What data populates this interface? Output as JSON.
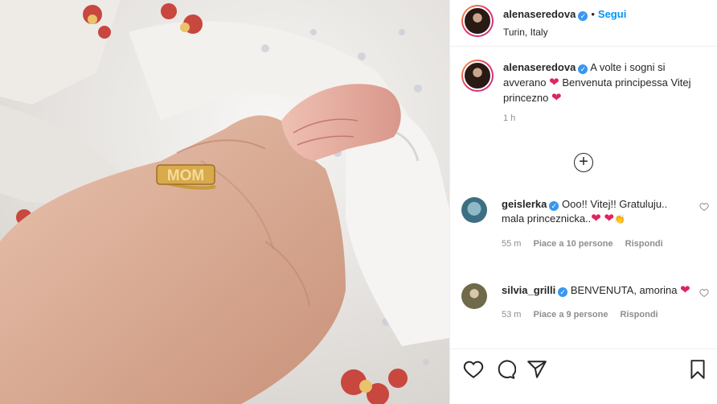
{
  "post": {
    "username": "alenaseredova",
    "follow_label": "Segui",
    "separator": "•",
    "location": "Turin, Italy"
  },
  "photo": {
    "ring_text": "MOM"
  },
  "caption": {
    "username": "alenaseredova",
    "text_1": "A volte i sogni si avverano",
    "text_2": "Benvenuta principessa Vitej princezno",
    "time": "1 h"
  },
  "comments": [
    {
      "username": "geislerka",
      "text": "Ooo!! Vitej!! Gratuluju.. mala princeznicka..",
      "time": "55 m",
      "likes": "Piace a 10 persone",
      "reply": "Rispondi"
    },
    {
      "username": "silvia_grilli",
      "text": "BENVENUTA, amorina",
      "time": "53 m",
      "likes": "Piace a 9 persone",
      "reply": "Rispondi"
    }
  ],
  "icons": {
    "verified": "verified-badge-icon",
    "load_more": "plus-circle-icon",
    "like": "heart-outline-icon",
    "comment": "comment-bubble-icon",
    "share": "paper-plane-icon",
    "save": "bookmark-icon"
  },
  "colors": {
    "follow": "#0095f6",
    "heart_emoji": "#e0245e",
    "verified": "#3897f0",
    "meta_gray": "#8e8e8e"
  }
}
